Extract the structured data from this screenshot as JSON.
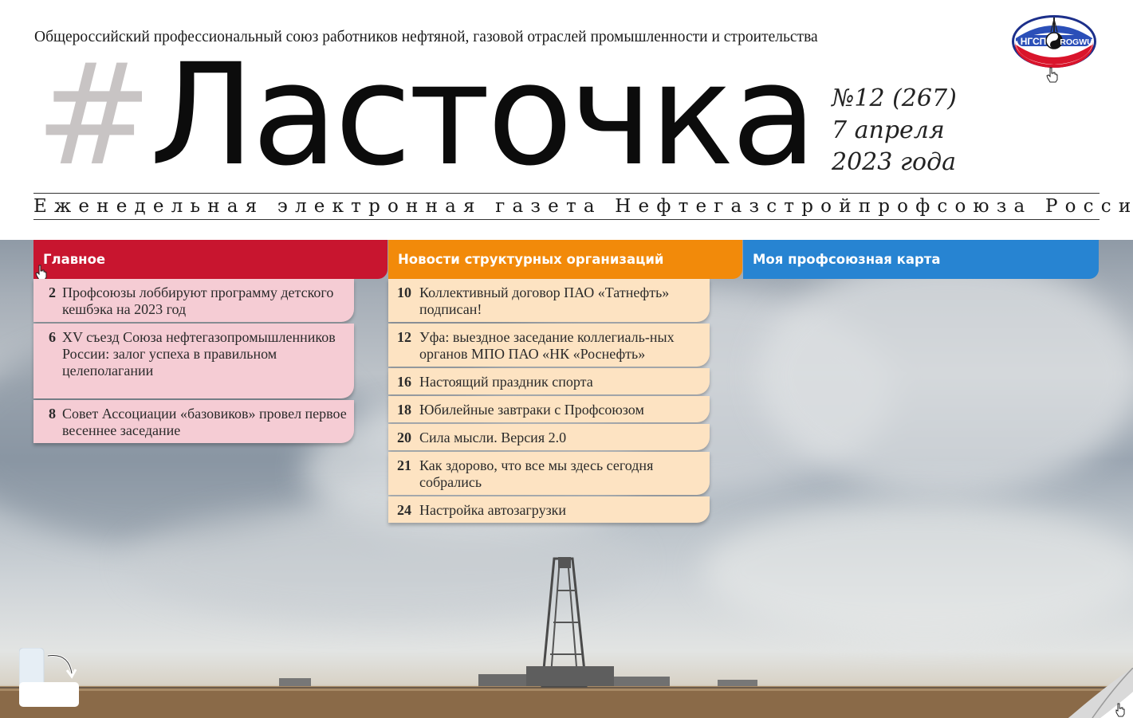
{
  "header": {
    "union_name": "Общероссийский профессиональный союз работников нефтяной, газовой отраслей промышленности и строительства",
    "masthead_hash": "#",
    "masthead_title": "Ласточка",
    "issue_number": "№12 (267)",
    "issue_date_line1": "7 апреля",
    "issue_date_line2": "2023 года",
    "tagline": "Еженедельная электронная газета Нефтегазстройпрофсоюза России",
    "logo": {
      "left_text": "НГСП",
      "right_text": "ROGWU"
    }
  },
  "tabs": [
    {
      "label": "Главное",
      "color": "#c8152f"
    },
    {
      "label": "Новости структурных организаций",
      "color": "#f28a0a"
    },
    {
      "label": "Моя профсоюзная карта",
      "color": "#2784d2"
    }
  ],
  "main_items": [
    {
      "page": "2",
      "title": "Профсоюзы лоббируют программу детского кешбэка на 2023 год"
    },
    {
      "page": "6",
      "title": "XV съезд Союза нефтегазопромышленников России: залог успеха в правильном целеполагании"
    },
    {
      "page": "8",
      "title": "Совет Ассоциации «базовиков» провел первое весеннее заседание"
    }
  ],
  "news_items": [
    {
      "page": "10",
      "title": "Коллективный договор ПАО «Татнефть» подписан!"
    },
    {
      "page": "12",
      "title": "Уфа: выездное заседание коллегиаль-ных органов МПО ПАО «НК «Роснефть»"
    },
    {
      "page": "16",
      "title": "Настоящий праздник спорта"
    },
    {
      "page": "18",
      "title": "Юбилейные завтраки с Профсоюзом"
    },
    {
      "page": "20",
      "title": "Сила мысли. Версия 2.0"
    },
    {
      "page": "21",
      "title": "Как здорово, что все мы здесь сегодня собрались"
    },
    {
      "page": "24",
      "title": "Настройка автозагрузки"
    }
  ],
  "icons": {
    "rotate": "rotate-device-icon",
    "page_curl": "page-turn-icon",
    "cursor": "hand-cursor-icon"
  }
}
